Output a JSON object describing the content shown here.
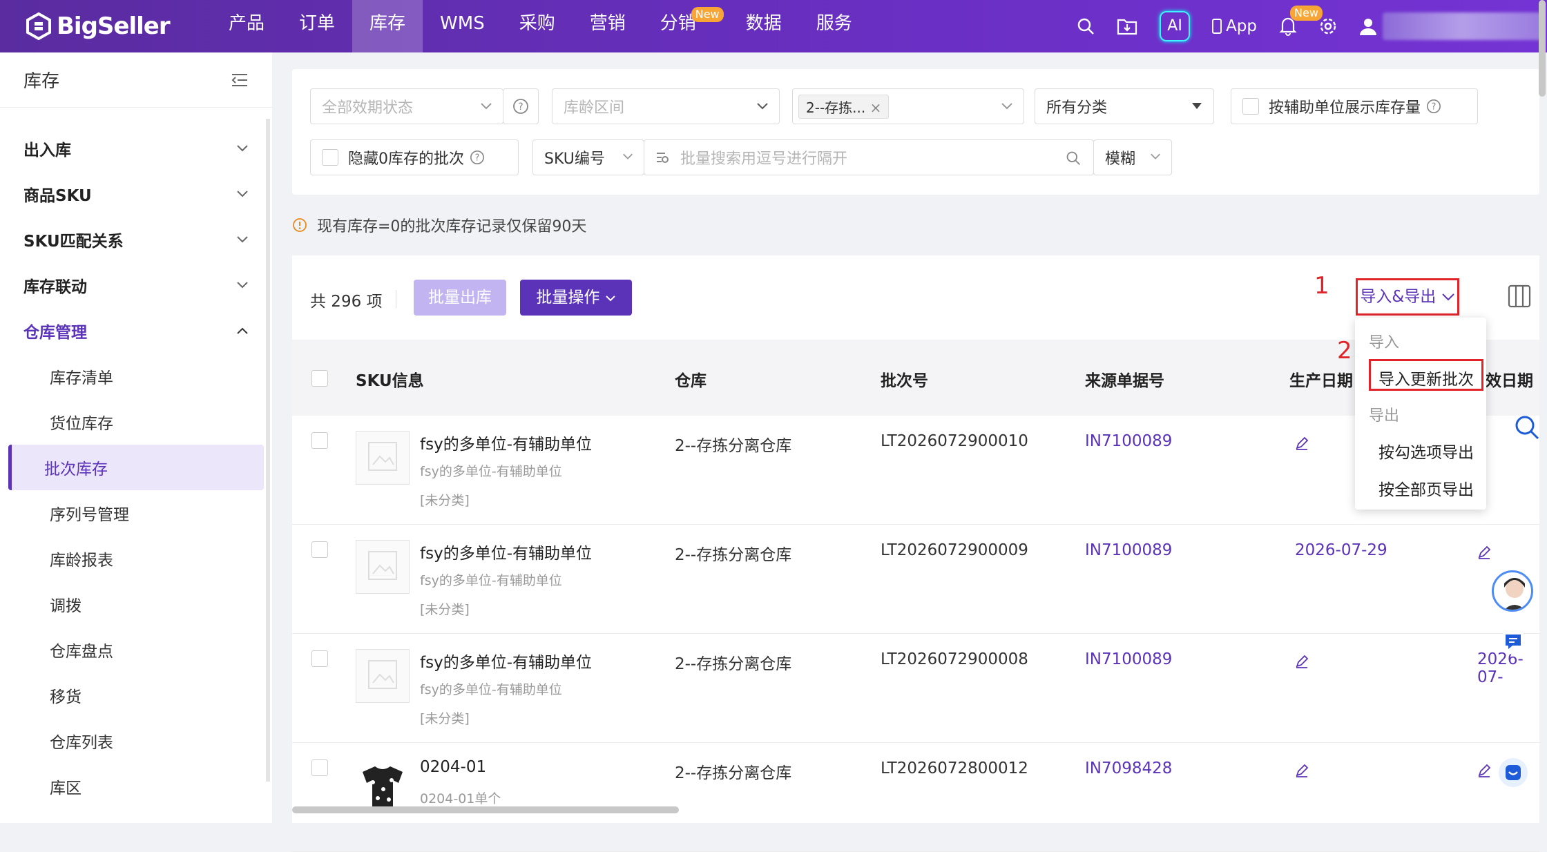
{
  "app": {
    "logo_text": "BigSeller"
  },
  "nav": {
    "items": [
      {
        "label": "产品"
      },
      {
        "label": "订单"
      },
      {
        "label": "库存"
      },
      {
        "label": "WMS"
      },
      {
        "label": "采购"
      },
      {
        "label": "营销"
      },
      {
        "label": "分销",
        "badge": "New"
      },
      {
        "label": "数据"
      },
      {
        "label": "服务"
      }
    ],
    "active": "库存",
    "right": {
      "ai_label": "AI",
      "app_label": "App",
      "bell_badge": "New"
    }
  },
  "sidebar": {
    "title": "库存",
    "groups": [
      {
        "label": "出入库"
      },
      {
        "label": "商品SKU"
      },
      {
        "label": "SKU匹配关系"
      },
      {
        "label": "库存联动"
      },
      {
        "label": "仓库管理"
      }
    ],
    "items": [
      {
        "label": "库存清单"
      },
      {
        "label": "货位库存"
      },
      {
        "label": "批次库存"
      },
      {
        "label": "序列号管理"
      },
      {
        "label": "库龄报表"
      },
      {
        "label": "调拨"
      },
      {
        "label": "仓库盘点"
      },
      {
        "label": "移货"
      },
      {
        "label": "仓库列表"
      },
      {
        "label": "库区"
      }
    ],
    "active_item": "批次库存"
  },
  "filters": {
    "validity_placeholder": "全部效期状态",
    "age_placeholder": "库龄区间",
    "warehouse_tag": "2--存拣...",
    "category": "所有分类",
    "aux_unit_label": "按辅助单位展示库存量",
    "hide_zero_label": "隐藏0库存的批次",
    "search_field": "SKU编号",
    "search_placeholder": "批量搜索用逗号进行隔开",
    "match_mode": "模糊"
  },
  "notice": "现有库存=0的批次库存记录仅保留90天",
  "toolbar": {
    "total": "共 296 项",
    "batch_out": "批量出库",
    "batch_ops": "批量操作",
    "import_export": "导入&导出",
    "anno_1": "1",
    "anno_2": "2"
  },
  "dropdown": {
    "import_header": "导入",
    "import_update_batch": "导入更新批次",
    "export_header": "导出",
    "export_selected": "按勾选项导出",
    "export_all": "按全部页导出"
  },
  "table": {
    "headers": {
      "sku": "SKU信息",
      "warehouse": "仓库",
      "batch": "批次号",
      "source": "来源单据号",
      "production_date": "生产日期",
      "expiry_date": "效日期"
    },
    "rows": [
      {
        "name": "fsy的多单位-有辅助单位",
        "sub": "fsy的多单位-有辅助单位",
        "cat": "[未分类]",
        "warehouse": "2--存拣分离仓库",
        "batch": "LT2026072900010",
        "source": "IN7100089",
        "prod": "",
        "exp": ""
      },
      {
        "name": "fsy的多单位-有辅助单位",
        "sub": "fsy的多单位-有辅助单位",
        "cat": "[未分类]",
        "warehouse": "2--存拣分离仓库",
        "batch": "LT2026072900009",
        "source": "IN7100089",
        "prod": "2026-07-29",
        "exp": ""
      },
      {
        "name": "fsy的多单位-有辅助单位",
        "sub": "fsy的多单位-有辅助单位",
        "cat": "[未分类]",
        "warehouse": "2--存拣分离仓库",
        "batch": "LT2026072900008",
        "source": "IN7100089",
        "prod": "",
        "exp": "2026-07-"
      },
      {
        "name": "0204-01",
        "sub": "0204-01单个",
        "cat": "",
        "warehouse": "2--存拣分离仓库",
        "batch": "LT2026072800012",
        "source": "IN7098428",
        "prod": "",
        "exp": ""
      }
    ]
  },
  "colors": {
    "brand": "#5b33b9",
    "accent_red": "#e0242a",
    "badge": "#f7a635"
  }
}
